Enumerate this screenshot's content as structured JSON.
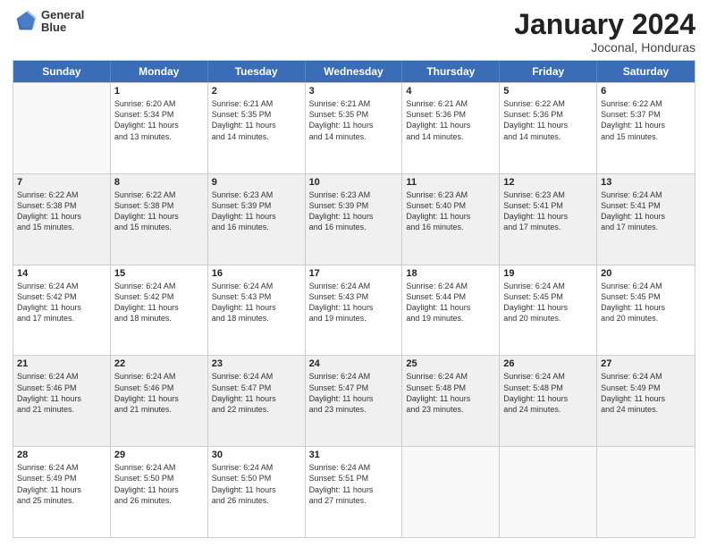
{
  "header": {
    "logo_line1": "General",
    "logo_line2": "Blue",
    "title": "January 2024",
    "subtitle": "Joconal, Honduras"
  },
  "days": [
    "Sunday",
    "Monday",
    "Tuesday",
    "Wednesday",
    "Thursday",
    "Friday",
    "Saturday"
  ],
  "weeks": [
    [
      {
        "num": "",
        "lines": [],
        "empty": true
      },
      {
        "num": "1",
        "lines": [
          "Sunrise: 6:20 AM",
          "Sunset: 5:34 PM",
          "Daylight: 11 hours",
          "and 13 minutes."
        ]
      },
      {
        "num": "2",
        "lines": [
          "Sunrise: 6:21 AM",
          "Sunset: 5:35 PM",
          "Daylight: 11 hours",
          "and 14 minutes."
        ]
      },
      {
        "num": "3",
        "lines": [
          "Sunrise: 6:21 AM",
          "Sunset: 5:35 PM",
          "Daylight: 11 hours",
          "and 14 minutes."
        ]
      },
      {
        "num": "4",
        "lines": [
          "Sunrise: 6:21 AM",
          "Sunset: 5:36 PM",
          "Daylight: 11 hours",
          "and 14 minutes."
        ]
      },
      {
        "num": "5",
        "lines": [
          "Sunrise: 6:22 AM",
          "Sunset: 5:36 PM",
          "Daylight: 11 hours",
          "and 14 minutes."
        ]
      },
      {
        "num": "6",
        "lines": [
          "Sunrise: 6:22 AM",
          "Sunset: 5:37 PM",
          "Daylight: 11 hours",
          "and 15 minutes."
        ]
      }
    ],
    [
      {
        "num": "7",
        "lines": [
          "Sunrise: 6:22 AM",
          "Sunset: 5:38 PM",
          "Daylight: 11 hours",
          "and 15 minutes."
        ]
      },
      {
        "num": "8",
        "lines": [
          "Sunrise: 6:22 AM",
          "Sunset: 5:38 PM",
          "Daylight: 11 hours",
          "and 15 minutes."
        ]
      },
      {
        "num": "9",
        "lines": [
          "Sunrise: 6:23 AM",
          "Sunset: 5:39 PM",
          "Daylight: 11 hours",
          "and 16 minutes."
        ]
      },
      {
        "num": "10",
        "lines": [
          "Sunrise: 6:23 AM",
          "Sunset: 5:39 PM",
          "Daylight: 11 hours",
          "and 16 minutes."
        ]
      },
      {
        "num": "11",
        "lines": [
          "Sunrise: 6:23 AM",
          "Sunset: 5:40 PM",
          "Daylight: 11 hours",
          "and 16 minutes."
        ]
      },
      {
        "num": "12",
        "lines": [
          "Sunrise: 6:23 AM",
          "Sunset: 5:41 PM",
          "Daylight: 11 hours",
          "and 17 minutes."
        ]
      },
      {
        "num": "13",
        "lines": [
          "Sunrise: 6:24 AM",
          "Sunset: 5:41 PM",
          "Daylight: 11 hours",
          "and 17 minutes."
        ]
      }
    ],
    [
      {
        "num": "14",
        "lines": [
          "Sunrise: 6:24 AM",
          "Sunset: 5:42 PM",
          "Daylight: 11 hours",
          "and 17 minutes."
        ]
      },
      {
        "num": "15",
        "lines": [
          "Sunrise: 6:24 AM",
          "Sunset: 5:42 PM",
          "Daylight: 11 hours",
          "and 18 minutes."
        ]
      },
      {
        "num": "16",
        "lines": [
          "Sunrise: 6:24 AM",
          "Sunset: 5:43 PM",
          "Daylight: 11 hours",
          "and 18 minutes."
        ]
      },
      {
        "num": "17",
        "lines": [
          "Sunrise: 6:24 AM",
          "Sunset: 5:43 PM",
          "Daylight: 11 hours",
          "and 19 minutes."
        ]
      },
      {
        "num": "18",
        "lines": [
          "Sunrise: 6:24 AM",
          "Sunset: 5:44 PM",
          "Daylight: 11 hours",
          "and 19 minutes."
        ]
      },
      {
        "num": "19",
        "lines": [
          "Sunrise: 6:24 AM",
          "Sunset: 5:45 PM",
          "Daylight: 11 hours",
          "and 20 minutes."
        ]
      },
      {
        "num": "20",
        "lines": [
          "Sunrise: 6:24 AM",
          "Sunset: 5:45 PM",
          "Daylight: 11 hours",
          "and 20 minutes."
        ]
      }
    ],
    [
      {
        "num": "21",
        "lines": [
          "Sunrise: 6:24 AM",
          "Sunset: 5:46 PM",
          "Daylight: 11 hours",
          "and 21 minutes."
        ]
      },
      {
        "num": "22",
        "lines": [
          "Sunrise: 6:24 AM",
          "Sunset: 5:46 PM",
          "Daylight: 11 hours",
          "and 21 minutes."
        ]
      },
      {
        "num": "23",
        "lines": [
          "Sunrise: 6:24 AM",
          "Sunset: 5:47 PM",
          "Daylight: 11 hours",
          "and 22 minutes."
        ]
      },
      {
        "num": "24",
        "lines": [
          "Sunrise: 6:24 AM",
          "Sunset: 5:47 PM",
          "Daylight: 11 hours",
          "and 23 minutes."
        ]
      },
      {
        "num": "25",
        "lines": [
          "Sunrise: 6:24 AM",
          "Sunset: 5:48 PM",
          "Daylight: 11 hours",
          "and 23 minutes."
        ]
      },
      {
        "num": "26",
        "lines": [
          "Sunrise: 6:24 AM",
          "Sunset: 5:48 PM",
          "Daylight: 11 hours",
          "and 24 minutes."
        ]
      },
      {
        "num": "27",
        "lines": [
          "Sunrise: 6:24 AM",
          "Sunset: 5:49 PM",
          "Daylight: 11 hours",
          "and 24 minutes."
        ]
      }
    ],
    [
      {
        "num": "28",
        "lines": [
          "Sunrise: 6:24 AM",
          "Sunset: 5:49 PM",
          "Daylight: 11 hours",
          "and 25 minutes."
        ]
      },
      {
        "num": "29",
        "lines": [
          "Sunrise: 6:24 AM",
          "Sunset: 5:50 PM",
          "Daylight: 11 hours",
          "and 26 minutes."
        ]
      },
      {
        "num": "30",
        "lines": [
          "Sunrise: 6:24 AM",
          "Sunset: 5:50 PM",
          "Daylight: 11 hours",
          "and 26 minutes."
        ]
      },
      {
        "num": "31",
        "lines": [
          "Sunrise: 6:24 AM",
          "Sunset: 5:51 PM",
          "Daylight: 11 hours",
          "and 27 minutes."
        ]
      },
      {
        "num": "",
        "lines": [],
        "empty": true
      },
      {
        "num": "",
        "lines": [],
        "empty": true
      },
      {
        "num": "",
        "lines": [],
        "empty": true
      }
    ]
  ]
}
